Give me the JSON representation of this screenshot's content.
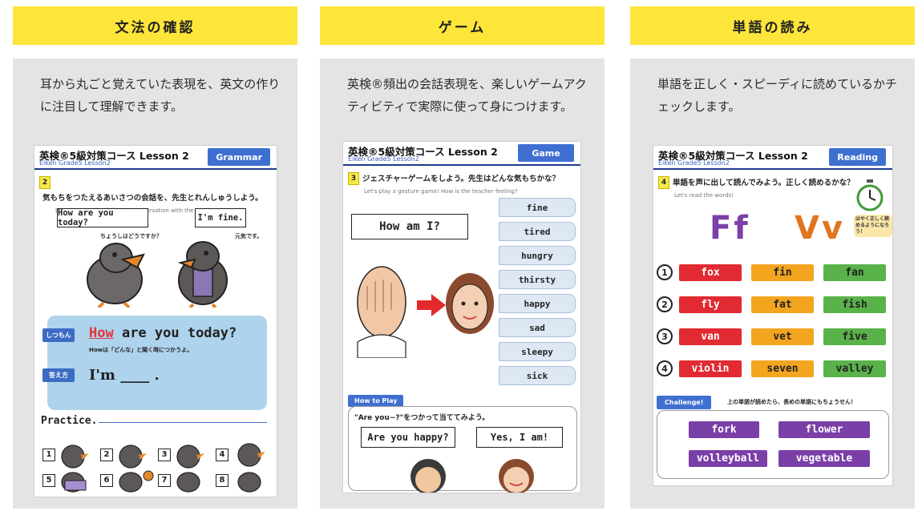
{
  "columns": [
    {
      "title": "文法の確認",
      "description": "耳から丸ごと覚えていた表現を、英文の作りに注目して理解できます。",
      "panel": {
        "title": "英検®5級対策コース Lesson 2",
        "subtitle": "Eiken Grade5 Lesson2",
        "tag": "Grammar",
        "question_number": "2",
        "question": "気もちをつたえるあいさつの会話を、先生とれんしゅうしよう。",
        "question_en": "Let's practice the following conversation with the teacher.",
        "bubble_left": "How are you today?",
        "bubble_left_sub": "ちょうしはどうですか？",
        "bubble_right": "I'm fine.",
        "bubble_right_sub": "元気です。",
        "ask_label": "しつもん",
        "ask_highlight": "How",
        "ask_rest": " are you today?",
        "ask_note": "Howは「どんな」と聞く時につかうよ。",
        "answer_label": "答え方",
        "answer_text": "I'm ____ .",
        "practice_label": "Practice.",
        "numbers": [
          "1",
          "2",
          "3",
          "4",
          "5",
          "6",
          "7",
          "8"
        ]
      }
    },
    {
      "title": "ゲーム",
      "description": "英検®頻出の会話表現を、楽しいゲームアクティビティで実際に使って身につけます。",
      "panel": {
        "title": "英検®5級対策コース Lesson 2",
        "subtitle": "Eiken Grade5 Lesson2",
        "tag": "Game",
        "question_number": "3",
        "question": "ジェスチャーゲームをしよう。先生はどんな気もちかな？",
        "question_en": "Let's play a gesture game! How is the teacher feeling?",
        "bubble": "How am I?",
        "words": [
          "fine",
          "tired",
          "hungry",
          "thirsty",
          "happy",
          "sad",
          "sleepy",
          "sick"
        ],
        "howto_label": "How to Play",
        "howto_text": "\"Are you~?\"をつかって当ててみよう。",
        "bubble_q": "Are you happy?",
        "bubble_a": "Yes, I am!"
      }
    },
    {
      "title": "単語の読み",
      "description": "単語を正しく・スピーディに読めているかチェックします。",
      "panel": {
        "title": "英検®5級対策コース Lesson 2",
        "subtitle": "Eiken Grade5 Lesson2",
        "tag": "Reading",
        "question_number": "4",
        "question": "単語を声に出して読んでみよう。正しく読めるかな？",
        "question_en": "Let's read the words!",
        "timer_note": "はやく正しく読めるようになろう！",
        "letter_left": "Ff",
        "letter_right": "Vv",
        "rows": [
          {
            "num": "1",
            "words": [
              "fox",
              "fin",
              "fan"
            ]
          },
          {
            "num": "2",
            "words": [
              "fly",
              "fat",
              "fish"
            ]
          },
          {
            "num": "3",
            "words": [
              "van",
              "vet",
              "five"
            ]
          },
          {
            "num": "4",
            "words": [
              "violin",
              "seven",
              "valley"
            ]
          }
        ],
        "challenge_label": "Challenge!",
        "challenge_text": "上の単語が読めたら、長めの単語にもちょうせん！",
        "challenge_words": [
          "fork",
          "flower",
          "volleyball",
          "vegetable"
        ]
      }
    }
  ],
  "colors": {
    "title_bar": "#fde53a",
    "card_bg": "#e4e4e4",
    "tag_blue": "#3f6fd0",
    "red": "#e12a32",
    "orange": "#f4a520",
    "green": "#59b24a",
    "purple": "#7b3fa8",
    "letter_f": "#7d3fa9",
    "letter_v": "#e0751f"
  }
}
